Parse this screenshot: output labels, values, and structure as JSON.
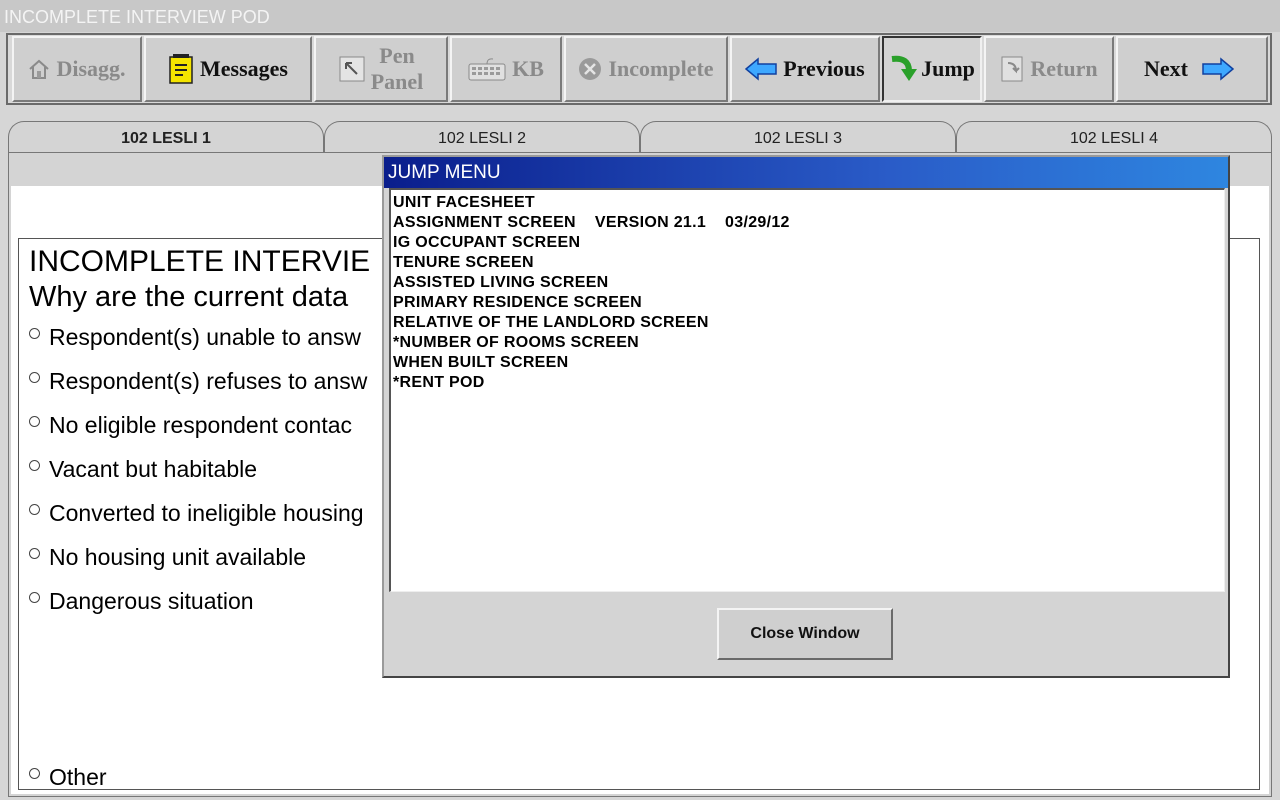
{
  "window": {
    "title": "INCOMPLETE INTERVIEW POD"
  },
  "toolbar": {
    "disagg": "Disagg.",
    "messages": "Messages",
    "pen_line1": "Pen",
    "pen_line2": "Panel",
    "kb": "KB",
    "incomplete": "Incomplete",
    "previous": "Previous",
    "jump": "Jump",
    "return": "Return",
    "next": "Next"
  },
  "tabs": [
    "102 LESLI 1",
    "102 LESLI 2",
    "102 LESLI 3",
    "102 LESLI 4"
  ],
  "question": {
    "title": "INCOMPLETE INTERVIE",
    "subtitle": "Why are the current data",
    "options": [
      "Respondent(s) unable to answ",
      "Respondent(s) refuses to answ",
      "No eligible respondent contac",
      "Vacant but habitable",
      "Converted to ineligible housing",
      "No housing unit available",
      "Dangerous situation",
      "Other"
    ]
  },
  "jump_menu": {
    "title": "JUMP MENU",
    "items": [
      "UNIT FACESHEET",
      "ASSIGNMENT SCREEN    VERSION 21.1    03/29/12",
      "IG OCCUPANT SCREEN",
      "TENURE SCREEN",
      "ASSISTED LIVING SCREEN",
      "PRIMARY RESIDENCE SCREEN",
      "RELATIVE OF THE LANDLORD SCREEN",
      "*NUMBER OF ROOMS SCREEN",
      "WHEN BUILT SCREEN",
      "*RENT POD"
    ],
    "close_label": "Close Window"
  },
  "colors": {
    "titlebar_gradient_start": "#0a1e8c",
    "titlebar_gradient_end": "#2e86e0",
    "arrow_blue": "#1e90ff",
    "jump_green": "#2aa02a"
  }
}
